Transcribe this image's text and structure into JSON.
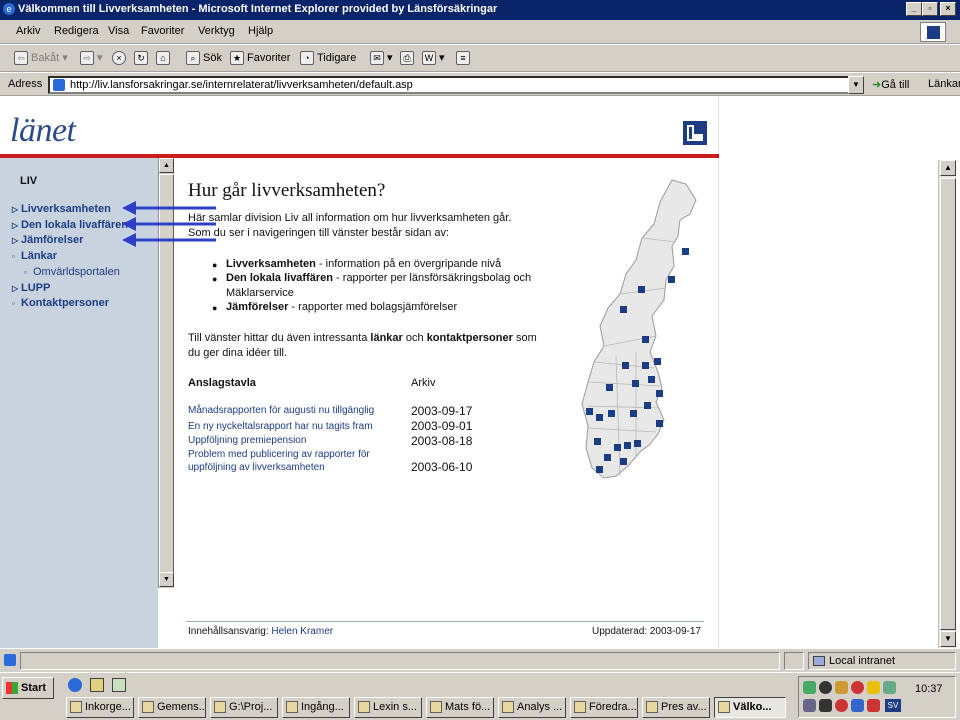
{
  "window": {
    "title": "Välkommen till Livverksamheten - Microsoft Internet Explorer provided by Länsförsäkringar",
    "min_label": "_",
    "max_label": "▫",
    "close_label": "×"
  },
  "menubar": [
    "Arkiv",
    "Redigera",
    "Visa",
    "Favoriter",
    "Verktyg",
    "Hjälp"
  ],
  "toolbar": {
    "back": "Bakåt",
    "search": "Sök",
    "favorites": "Favoriter",
    "history": "Tidigare"
  },
  "address": {
    "label": "Adress",
    "url": "http://liv.lansforsakringar.se/internrelaterat/livverksamheten/default.asp",
    "go": "Gå till",
    "links": "Länkar"
  },
  "site": {
    "logo": "länet"
  },
  "sidebar": {
    "heading": "LIV",
    "items": [
      {
        "label": "Livverksamheten",
        "marker": "▷"
      },
      {
        "label": "Den lokala livaffären",
        "marker": "▷"
      },
      {
        "label": "Jämförelser",
        "marker": "▷"
      },
      {
        "label": "Länkar",
        "marker": "▫"
      },
      {
        "label": "Omvärldsportalen",
        "marker": "▫"
      },
      {
        "label": "LUPP",
        "marker": "▷"
      },
      {
        "label": "Kontaktpersoner",
        "marker": "▫"
      }
    ]
  },
  "main": {
    "heading": "Hur går livverksamheten?",
    "intro1": "Här samlar division Liv all information om hur livverksamheten går.",
    "intro2": "Som du ser i navigeringen till vänster består sidan av:",
    "bullets": [
      {
        "bold": "Livverksamheten",
        "rest": " - information på en övergripande nivå",
        "rest2": ""
      },
      {
        "bold": "Den lokala livaffären",
        "rest": " - rapporter per länsförsäkringsbolag och",
        "rest2": "Mäklarservice"
      },
      {
        "bold": "Jämförelser",
        "rest": " - rapporter med bolagsjämförelser",
        "rest2": ""
      }
    ],
    "para_a": "Till vänster hittar du även intressanta ",
    "para_b": "länkar",
    "para_c": " och ",
    "para_d": "kontaktpersoner",
    "para_e": " som",
    "para_f": "du ger dina idéer till.",
    "board_heading": "Anslagstavla",
    "archive_heading": "Arkiv",
    "board": [
      {
        "title": "Månadsrapporten för augusti nu tillgänglig",
        "date": "2003-09-17"
      },
      {
        "title": "En ny nyckeltalsrapport har nu tagits fram",
        "date": "2003-09-01"
      },
      {
        "title": "Uppföljning premiepension",
        "date": "2003-08-18"
      },
      {
        "title": "Problem med publicering av rapporter för",
        "title2": "uppföljning av livverksamheten",
        "date": "2003-06-10"
      }
    ],
    "footer_label": "Innehållsansvarig: ",
    "footer_name": "Helen Kramer",
    "updated": "Uppdaterad: 2003-09-17"
  },
  "statusbar": {
    "zone": "Local intranet"
  },
  "taskbar": {
    "start": "Start",
    "tasks": [
      "Inkorge...",
      "Gemens...",
      "G:\\Proj...",
      "Ingång...",
      "Lexin s...",
      "Mats fö...",
      "Analys ...",
      "Föredra...",
      "Pres av...",
      "Välko..."
    ],
    "clock": "10:37",
    "lang": "SV"
  },
  "colors": {
    "accent": "#1c3c84",
    "red_rule": "#cc1b1b",
    "sidebar_bg": "#c9d3e0",
    "titlebar": "#0a246a",
    "annotation_arrows": "#2b3fc8"
  }
}
